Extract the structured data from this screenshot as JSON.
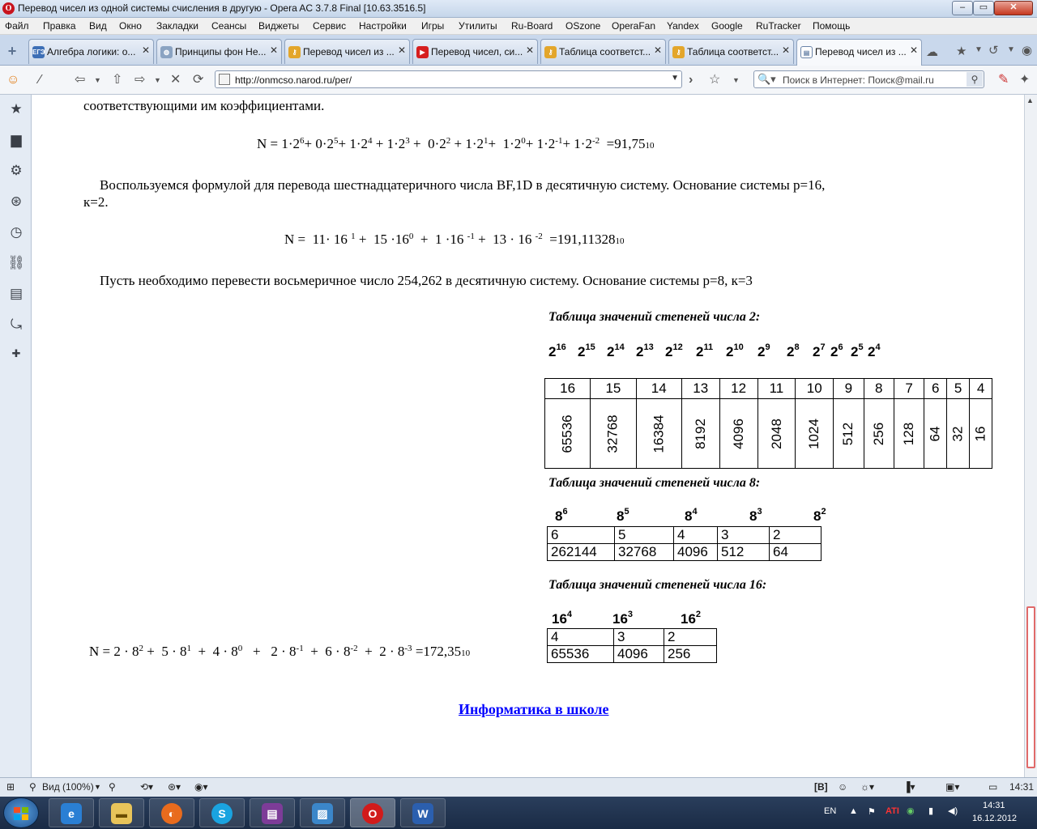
{
  "window": {
    "title": "Перевод чисел из одной системы счисления в другую - Opera AC 3.7.8 Final [10.63.3516.5]",
    "app_icon": "opera-icon"
  },
  "menu": [
    "Файл",
    "Правка",
    "Вид",
    "Окно",
    "Закладки",
    "Сеансы",
    "Виджеты",
    "Сервис",
    "Настройки",
    "Игры",
    "Утилиты",
    "Ru-Board",
    "OSzone",
    "OperaFan",
    "Yandex",
    "Google",
    "RuTracker",
    "Помощь"
  ],
  "tabs": [
    {
      "label": "Алгебра логики: о...",
      "icon": "ЕГЭ"
    },
    {
      "label": "Принципы фон Не...",
      "icon": "globe"
    },
    {
      "label": "Перевод чисел из ...",
      "icon": "key"
    },
    {
      "label": "Перевод чисел, си...",
      "icon": "youtube"
    },
    {
      "label": "Таблица соответст...",
      "icon": "key"
    },
    {
      "label": "Таблица соответст...",
      "icon": "key"
    },
    {
      "label": "Перевод чисел из ...",
      "icon": "page"
    }
  ],
  "address": {
    "url": "http://onmcso.narod.ru/per/"
  },
  "search": {
    "placeholder": "Поиск в Интернет: Поиск@mail.ru"
  },
  "page": {
    "intro": "соответствующими им коэффициентами.",
    "formula_bin": {
      "prefix": "N = ",
      "result": "=91,75",
      "base": "10"
    },
    "hex_text_1": "Воспользуемся формулой для перевода шестнадцатеричного числа BF,1D в десятичную систему. Основание системы р=16,",
    "hex_text_2": "к=2.",
    "formula_hex": {
      "prefix": "N = ",
      "result": "=191,11328",
      "base": "10"
    },
    "oct_text": "Пусть необходимо перевести восьмеричное число 254,262 в десятичную систему. Основание системы р=8, к=3",
    "formula_oct": {
      "prefix": "N = ",
      "result": "=172,35",
      "base": "10"
    },
    "table2": {
      "caption": "Таблица значений степеней числа 2:",
      "base": "2",
      "powers": [
        "16",
        "15",
        "14",
        "13",
        "12",
        "11",
        "10",
        "9",
        "8",
        "7",
        "6",
        "5",
        "4"
      ],
      "values": [
        "65536",
        "32768",
        "16384",
        "8192",
        "4096",
        "2048",
        "1024",
        "512",
        "256",
        "128",
        "64",
        "32",
        "16"
      ]
    },
    "table8": {
      "caption": "Таблица значений степеней числа 8:",
      "base": "8",
      "powers": [
        "6",
        "5",
        "4",
        "3",
        "2"
      ],
      "values": [
        "262144",
        "32768",
        "4096",
        "512",
        "64"
      ]
    },
    "table16": {
      "caption": "Таблица значений степеней числа 16:",
      "base": "16",
      "powers": [
        "4",
        "3",
        "2"
      ],
      "values": [
        "65536",
        "4096",
        "256"
      ]
    },
    "footer_link": "Информатика в школе"
  },
  "status": {
    "zoom": "Вид (100%)",
    "time": "14:31"
  },
  "taskbar": {
    "lang": "EN",
    "time": "14:31",
    "date": "16.12.2012",
    "apps": [
      "ie-icon",
      "explorer-icon",
      "firefox-icon",
      "skype-icon",
      "winrar-icon",
      "photo-viewer-icon",
      "opera-icon",
      "word-icon"
    ]
  }
}
